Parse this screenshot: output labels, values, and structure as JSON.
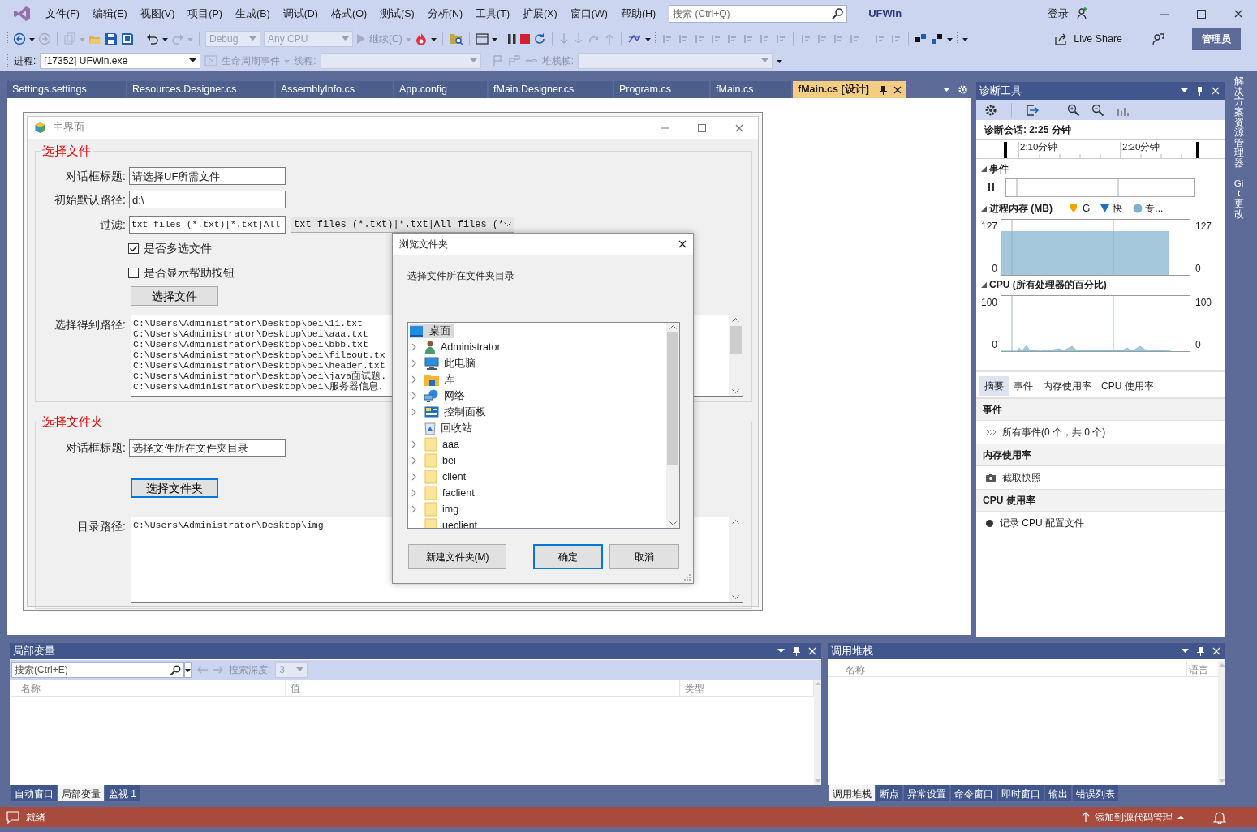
{
  "window": {
    "title": "UFWin",
    "sign_in": "登录",
    "badge": "管理员"
  },
  "menu": [
    "文件(F)",
    "编辑(E)",
    "视图(V)",
    "项目(P)",
    "生成(B)",
    "调试(D)",
    "格式(O)",
    "测试(S)",
    "分析(N)",
    "工具(T)",
    "扩展(X)",
    "窗口(W)",
    "帮助(H)"
  ],
  "search": {
    "placeholder": "搜索 (Ctrl+Q)"
  },
  "toolbar": {
    "configuration": "Debug",
    "platform": "Any CPU",
    "continue": "继续(C)",
    "live_share": "Live Share"
  },
  "debug_location": {
    "process_label": "进程:",
    "process": "[17352] UFWin.exe",
    "lifecycle": "生命周期事件",
    "thread_label": "线程:",
    "stack_label": "堆栈帧:"
  },
  "document_tabs": [
    {
      "label": "Settings.settings",
      "selected": false
    },
    {
      "label": "Resources.Designer.cs",
      "selected": false
    },
    {
      "label": "AssemblyInfo.cs",
      "selected": false
    },
    {
      "label": "App.config",
      "selected": false
    },
    {
      "label": "fMain.Designer.cs",
      "selected": false
    },
    {
      "label": "Program.cs",
      "selected": false
    },
    {
      "label": "fMain.cs",
      "selected": false
    },
    {
      "label": "fMain.cs [设计]",
      "selected": true
    }
  ],
  "form": {
    "title": "主界面",
    "file_group": {
      "legend": "选择文件",
      "fields": [
        {
          "label": "对话框标题:",
          "value": "请选择UF所需文件"
        },
        {
          "label": "初始默认路径:",
          "value": "d:\\"
        },
        {
          "label": "过滤:",
          "value": "txt files (*.txt)|*.txt|All"
        }
      ],
      "filter_combo": "txt files (*.txt)|*.txt|All files (*",
      "checkboxes": [
        {
          "label": "是否多选文件",
          "checked": true
        },
        {
          "label": "是否显示帮助按钮",
          "checked": false
        }
      ],
      "button": {
        "label": "选择文件",
        "focused": false
      },
      "result_label": "选择得到路径:",
      "result_lines": [
        "C:\\Users\\Administrator\\Desktop\\bei\\11.txt",
        "C:\\Users\\Administrator\\Desktop\\bei\\aaa.txt",
        "C:\\Users\\Administrator\\Desktop\\bei\\bbb.txt",
        "C:\\Users\\Administrator\\Desktop\\bei\\fileout.tx",
        "C:\\Users\\Administrator\\Desktop\\bei\\header.txt",
        "C:\\Users\\Administrator\\Desktop\\bei\\java面试题.",
        "C:\\Users\\Administrator\\Desktop\\bei\\服务器信息."
      ]
    },
    "folder_group": {
      "legend": "选择文件夹",
      "field": {
        "label": "对话框标题:",
        "value": "选择文件所在文件夹目录"
      },
      "button": {
        "label": "选择文件夹",
        "focused": true
      },
      "path_label": "目录路径:",
      "path_value": "C:\\Users\\Administrator\\Desktop\\img"
    }
  },
  "folder_dialog": {
    "title": "浏览文件夹",
    "description": "选择文件所在文件夹目录",
    "tree": [
      {
        "label": "桌面",
        "kind": "desktop",
        "selected": true,
        "expandable": false,
        "children": [
          {
            "label": "Administrator",
            "kind": "user",
            "selected": false,
            "expandable": true
          },
          {
            "label": "此电脑",
            "kind": "computer",
            "selected": false,
            "expandable": true
          },
          {
            "label": "库",
            "kind": "library",
            "selected": false,
            "expandable": true
          },
          {
            "label": "网络",
            "kind": "network",
            "selected": false,
            "expandable": true
          },
          {
            "label": "控制面板",
            "kind": "control-panel",
            "selected": false,
            "expandable": true
          },
          {
            "label": "回收站",
            "kind": "recycle-bin",
            "selected": false,
            "expandable": false
          },
          {
            "label": "aaa",
            "kind": "folder",
            "selected": false,
            "expandable": true
          },
          {
            "label": "bei",
            "kind": "folder",
            "selected": false,
            "expandable": true
          },
          {
            "label": "client",
            "kind": "folder",
            "selected": false,
            "expandable": true
          },
          {
            "label": "faclient",
            "kind": "folder",
            "selected": false,
            "expandable": true
          },
          {
            "label": "img",
            "kind": "folder",
            "selected": false,
            "expandable": true
          },
          {
            "label": "ueclient",
            "kind": "folder",
            "selected": false,
            "expandable": false
          }
        ]
      }
    ],
    "buttons": [
      {
        "label": "新建文件夹(M)",
        "default": false
      },
      {
        "label": "确定",
        "default": true
      },
      {
        "label": "取消",
        "default": false
      }
    ]
  },
  "diagnostics": {
    "title": "诊断工具",
    "session": "诊断会话: 2:25 分钟",
    "ticks": [
      "2:10分钟",
      "2:20分钟"
    ],
    "events_header": "事件",
    "memory_header": "进程内存 (MB)",
    "memory_legend": [
      {
        "label": "G",
        "color": "#f5a300"
      },
      {
        "label": "快",
        "color": "#1c6fc4"
      },
      {
        "label": "专...",
        "color": "#7eb1cf"
      }
    ],
    "memory_axis": {
      "left_max": "127",
      "left_min": "0",
      "right_max": "127",
      "right_min": "0"
    },
    "cpu_header": "CPU (所有处理器的百分比)",
    "cpu_axis": {
      "left_max": "100",
      "left_min": "0",
      "right_max": "100",
      "right_min": "0"
    },
    "tabs": [
      {
        "label": "摘要",
        "selected": true
      },
      {
        "label": "事件",
        "selected": false
      },
      {
        "label": "内存使用率",
        "selected": false
      },
      {
        "label": "CPU 使用率",
        "selected": false
      }
    ],
    "sections": [
      {
        "header": "事件",
        "kind": "events",
        "item": "所有事件(0 个，共 0 个)"
      },
      {
        "header": "内存使用率",
        "kind": "snapshot",
        "item": "截取快照"
      },
      {
        "header": "CPU 使用率",
        "kind": "record",
        "item": "记录 CPU 配置文件"
      }
    ]
  },
  "side_tabs": [
    "解决方案资源管理器",
    "Git 更改"
  ],
  "locals_panel": {
    "title": "局部变量",
    "search_placeholder": "搜索(Ctrl+E)",
    "depth_label": "搜索深度:",
    "depth": "3",
    "columns": [
      "名称",
      "值",
      "类型"
    ],
    "tabs": [
      {
        "label": "自动窗口",
        "selected": false
      },
      {
        "label": "局部变量",
        "selected": true
      },
      {
        "label": "监视 1",
        "selected": false
      }
    ]
  },
  "call_stack_panel": {
    "title": "调用堆栈",
    "columns": [
      "名称",
      "语言"
    ],
    "tabs": [
      {
        "label": "调用堆栈",
        "selected": true
      },
      {
        "label": "断点",
        "selected": false
      },
      {
        "label": "异常设置",
        "selected": false
      },
      {
        "label": "命令窗口",
        "selected": false
      },
      {
        "label": "即时窗口",
        "selected": false
      },
      {
        "label": "输出",
        "selected": false
      },
      {
        "label": "错误列表",
        "selected": false
      }
    ]
  },
  "status_bar": {
    "text": "就绪",
    "source_control": "添加到源代码管理"
  }
}
